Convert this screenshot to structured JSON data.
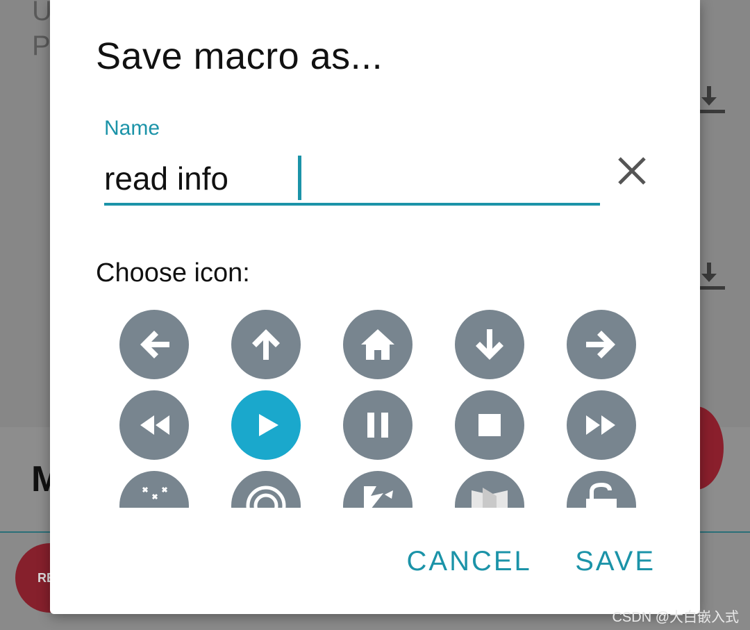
{
  "background": {
    "letters": [
      "U",
      "P"
    ],
    "m_letter": "M",
    "record_button_label": "RE"
  },
  "dialog": {
    "title": "Save macro as...",
    "name_field": {
      "label": "Name",
      "value": "read info"
    },
    "choose_icon_label": "Choose icon:",
    "icons": [
      {
        "name": "arrow-left-icon",
        "selected": false
      },
      {
        "name": "arrow-up-icon",
        "selected": false
      },
      {
        "name": "home-icon",
        "selected": false
      },
      {
        "name": "arrow-down-icon",
        "selected": false
      },
      {
        "name": "arrow-right-icon",
        "selected": false
      },
      {
        "name": "rewind-icon",
        "selected": false
      },
      {
        "name": "play-icon",
        "selected": true
      },
      {
        "name": "pause-icon",
        "selected": false
      },
      {
        "name": "stop-icon",
        "selected": false
      },
      {
        "name": "fast-forward-icon",
        "selected": false
      },
      {
        "name": "magic-wand-icon",
        "selected": false
      },
      {
        "name": "target-icon",
        "selected": false
      },
      {
        "name": "lightning-icon",
        "selected": false
      },
      {
        "name": "shield-icon",
        "selected": false
      },
      {
        "name": "unlock-icon",
        "selected": false
      }
    ],
    "actions": {
      "cancel": "CANCEL",
      "save": "SAVE"
    }
  },
  "colors": {
    "accent": "#1b93a8",
    "icon_default": "#78858f",
    "icon_selected": "#1aa8cc"
  },
  "watermark": "CSDN @大白嵌入式"
}
